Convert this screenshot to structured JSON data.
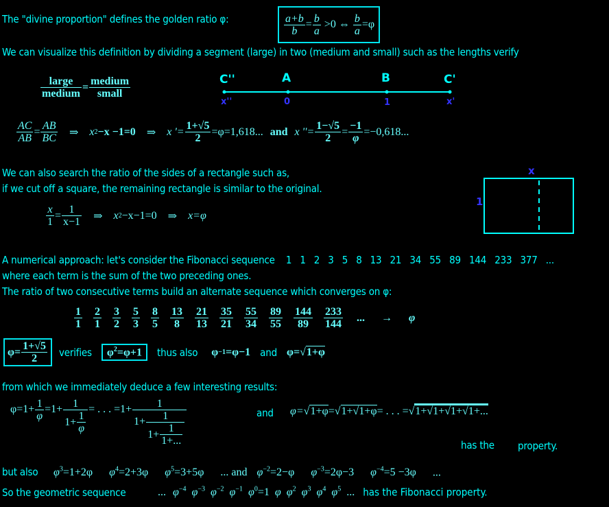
{
  "line1": {
    "text": "The \"divine proportion\" defines the golden ratio φ:",
    "formula": {
      "f1_num": "a+b",
      "f1_den": "b",
      "eq": "=",
      "f2_num": "b",
      "f2_den": "a",
      "gt": ">0 ⇔",
      "f3_num": "b",
      "f3_den": "a",
      "tail": "=φ"
    }
  },
  "line2": {
    "text": "We can visualize this definition by dividing a segment (large) in two (medium and small) such as the lengths verify"
  },
  "ratio_words": {
    "num1": "large",
    "den1": "medium",
    "eq": "=",
    "num2": "medium",
    "den2": "small"
  },
  "segment": {
    "points": [
      {
        "label": "C''",
        "sub": "x''"
      },
      {
        "label": "A",
        "sub": "0"
      },
      {
        "label": "B",
        "sub": "1"
      },
      {
        "label": "C'",
        "sub": "x'"
      }
    ],
    "line_color": "#00ffff",
    "sub_color": "#3333ff"
  },
  "eq_line": {
    "f1_num": "AC",
    "f1_den": "AB",
    "eq": "=",
    "f2_num": "AB",
    "f2_den": "BC",
    "implies1": "⇒",
    "quad_a": "x",
    "quad_exp": "2",
    "quad_b": "−x −1=0",
    "implies2": "⇒",
    "xp": "x '=",
    "r1_num": "1+√5",
    "r1_den": "2",
    "r1_tail": "=φ=1,618...",
    "and": "and",
    "xpp": "x ''=",
    "r2_num": "1−√5",
    "r2_den": "2",
    "eq2": "=",
    "r3_num": "−1",
    "r3_den": "φ",
    "r3_tail": "=−0,618..."
  },
  "rect_section": {
    "line1": "We can also search the ratio of the sides of a rectangle such as,",
    "line2": "if we cut off a square, the remaining rectangle is similar to the original.",
    "eq": {
      "f1_num": "x",
      "f1_den": "1",
      "eq": "=",
      "f2_num": "1",
      "f2_den": "x−1",
      "implies1": "⇒",
      "quad_a": "x",
      "quad_exp": "2",
      "quad_b": "−x−1=0",
      "implies2": "⇒",
      "result": "x=φ"
    },
    "diagram": {
      "top_label": "x",
      "side_label": "1"
    }
  },
  "fib_section": {
    "line1": "A numerical approach: let's consider the Fibonacci sequence",
    "sequence": [
      "1",
      "1",
      "2",
      "3",
      "5",
      "8",
      "13",
      "21",
      "34",
      "55",
      "89",
      "144",
      "233",
      "377",
      "..."
    ],
    "line2": "where each term is the sum of the two preceding ones.",
    "line3": "The ratio of two consecutive terms build an alternate sequence which converges on φ:",
    "ratios": [
      {
        "n": "1",
        "d": "1"
      },
      {
        "n": "2",
        "d": "1"
      },
      {
        "n": "3",
        "d": "2"
      },
      {
        "n": "5",
        "d": "3"
      },
      {
        "n": "8",
        "d": "5"
      },
      {
        "n": "13",
        "d": "8"
      },
      {
        "n": "21",
        "d": "13"
      },
      {
        "n": "35",
        "d": "21"
      },
      {
        "n": "55",
        "d": "34"
      },
      {
        "n": "89",
        "d": "55"
      },
      {
        "n": "144",
        "d": "89"
      },
      {
        "n": "233",
        "d": "144"
      }
    ],
    "ratio_tail": "...",
    "arrow": "→",
    "limit": "φ"
  },
  "phi_line": {
    "phi_lhs": "φ=",
    "phi_num": "1+√5",
    "phi_den": "2",
    "verifies": "verifies",
    "box2_a": "φ",
    "box2_exp": "2",
    "box2_b": "=φ+1",
    "thus_also": "thus also",
    "inv_a": "φ",
    "inv_exp": "−1",
    "inv_b": "=φ−1",
    "and": "and",
    "sqrt_lhs": "φ=√",
    "sqrt_arg": "1+φ"
  },
  "deduce": {
    "text": "from which we immediately deduce a few interesting results:"
  },
  "cont_frac": {
    "lhs": "φ=1+",
    "f1_num": "1",
    "f1_den": "φ",
    "eq1": "=1+",
    "f2_num": "1",
    "f2_den_a": "1+",
    "f2_den_num": "1",
    "f2_den_den": "φ",
    "eq2": "= . . . =1+",
    "f3_num": "1",
    "f3_a": "1+",
    "f3_b_num": "1",
    "f3_c": "1+",
    "f3_c_num": "1",
    "f3_c_den": "1+..."
  },
  "nested": {
    "and": "and",
    "text1": "φ=√",
    "a1": "1+φ",
    "t2": "=√",
    "a2": "1+√1+φ",
    "t3": "= . . . =√",
    "a3": "1+√1+√1+√1+..."
  },
  "has_the": {
    "a": "has the",
    "b": "property."
  },
  "powers": {
    "but_also": "but also",
    "items": [
      {
        "base": "φ",
        "exp": "3",
        "rhs": "=1+2φ"
      },
      {
        "base": "φ",
        "exp": "4",
        "rhs": "=2+3φ"
      },
      {
        "base": "φ",
        "exp": "5",
        "rhs": "=3+5φ"
      }
    ],
    "mid": "... and",
    "neg_items": [
      {
        "base": "φ",
        "exp": "−2",
        "rhs": "=2−φ"
      },
      {
        "base": "φ",
        "exp": "−3",
        "rhs": "=2φ−3"
      },
      {
        "base": "φ",
        "exp": "−4",
        "rhs": "=5 −3φ"
      }
    ],
    "tail": "..."
  },
  "geometric": {
    "lead": "So the geometric sequence",
    "dots": "...",
    "terms": [
      {
        "b": "φ",
        "e": "−4"
      },
      {
        "b": "φ",
        "e": "−3"
      },
      {
        "b": "φ",
        "e": "−2"
      },
      {
        "b": "φ",
        "e": "−1"
      },
      {
        "b": "φ",
        "e": "0",
        "tail": "=1"
      },
      {
        "b": "φ",
        "e": ""
      },
      {
        "b": "φ",
        "e": "2"
      },
      {
        "b": "φ",
        "e": "3"
      },
      {
        "b": "φ",
        "e": "4"
      },
      {
        "b": "φ",
        "e": "5"
      }
    ],
    "dots2": "...",
    "tail": "has the Fibonacci property."
  }
}
